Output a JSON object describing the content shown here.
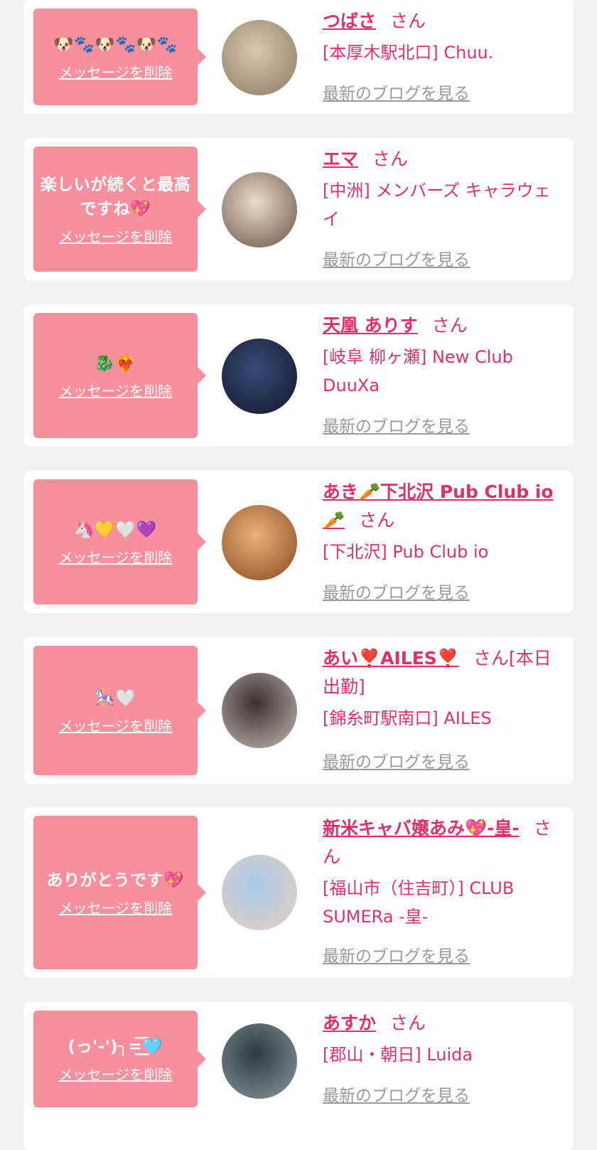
{
  "delete_label": "メッセージを削除",
  "blog_label": "最新のブログを見る",
  "honorific": "さん",
  "colors": {
    "accent": "#e0306a",
    "bubble": "#f88f9c",
    "background": "#f2f2f2",
    "card": "#ffffff",
    "blog_link": "#999999"
  },
  "items": [
    {
      "message": "🐶🐾🐶🐾🐶🐾",
      "name": "つばさ",
      "name_suffix": "",
      "shop": "[本厚木駅北口] Chuu.",
      "avatar_colors": [
        "#d8c8b0",
        "#8a7a62"
      ]
    },
    {
      "message": "楽しいが続くと最高ですね💖",
      "name": "エマ",
      "name_suffix": "",
      "shop": "[中洲] メンバーズ キャラウェイ",
      "avatar_colors": [
        "#e8dccf",
        "#6b5240"
      ]
    },
    {
      "message": "🐉❤️‍🔥",
      "name": "天凰 ありす",
      "name_suffix": "",
      "shop": "[岐阜 柳ヶ瀬] New Club DuuXa",
      "avatar_colors": [
        "#3a4a7a",
        "#101828"
      ]
    },
    {
      "message": "🦄💛🤍💜",
      "name": "あき🥕下北沢 Pub Club io 🥕",
      "name_suffix": "",
      "shop": "[下北沢] Pub Club io",
      "avatar_colors": [
        "#e9b07a",
        "#8a4a20"
      ]
    },
    {
      "message": "🎠🤍",
      "name": "あい❣️AILES❣️",
      "name_suffix": "[本日出勤]",
      "shop": "[錦糸町駅南口] AILES",
      "avatar_colors": [
        "#3a3030",
        "#c8b8b0"
      ]
    },
    {
      "message": "ありがとうです💖",
      "name": "新米キャバ嬢あみ💖-皇-",
      "name_suffix": "",
      "shop": "[福山市（住吉町）] CLUB SUMERa -皇-",
      "avatar_colors": [
        "#a8c8e8",
        "#e8d0c0"
      ]
    },
    {
      "message": "(っ'-')╮=͟͟͞͞🩵",
      "name": "あすか",
      "name_suffix": "",
      "shop": "[郡山・朝日] Luida",
      "avatar_colors": [
        "#2a3a40",
        "#8a9aa0"
      ]
    }
  ]
}
